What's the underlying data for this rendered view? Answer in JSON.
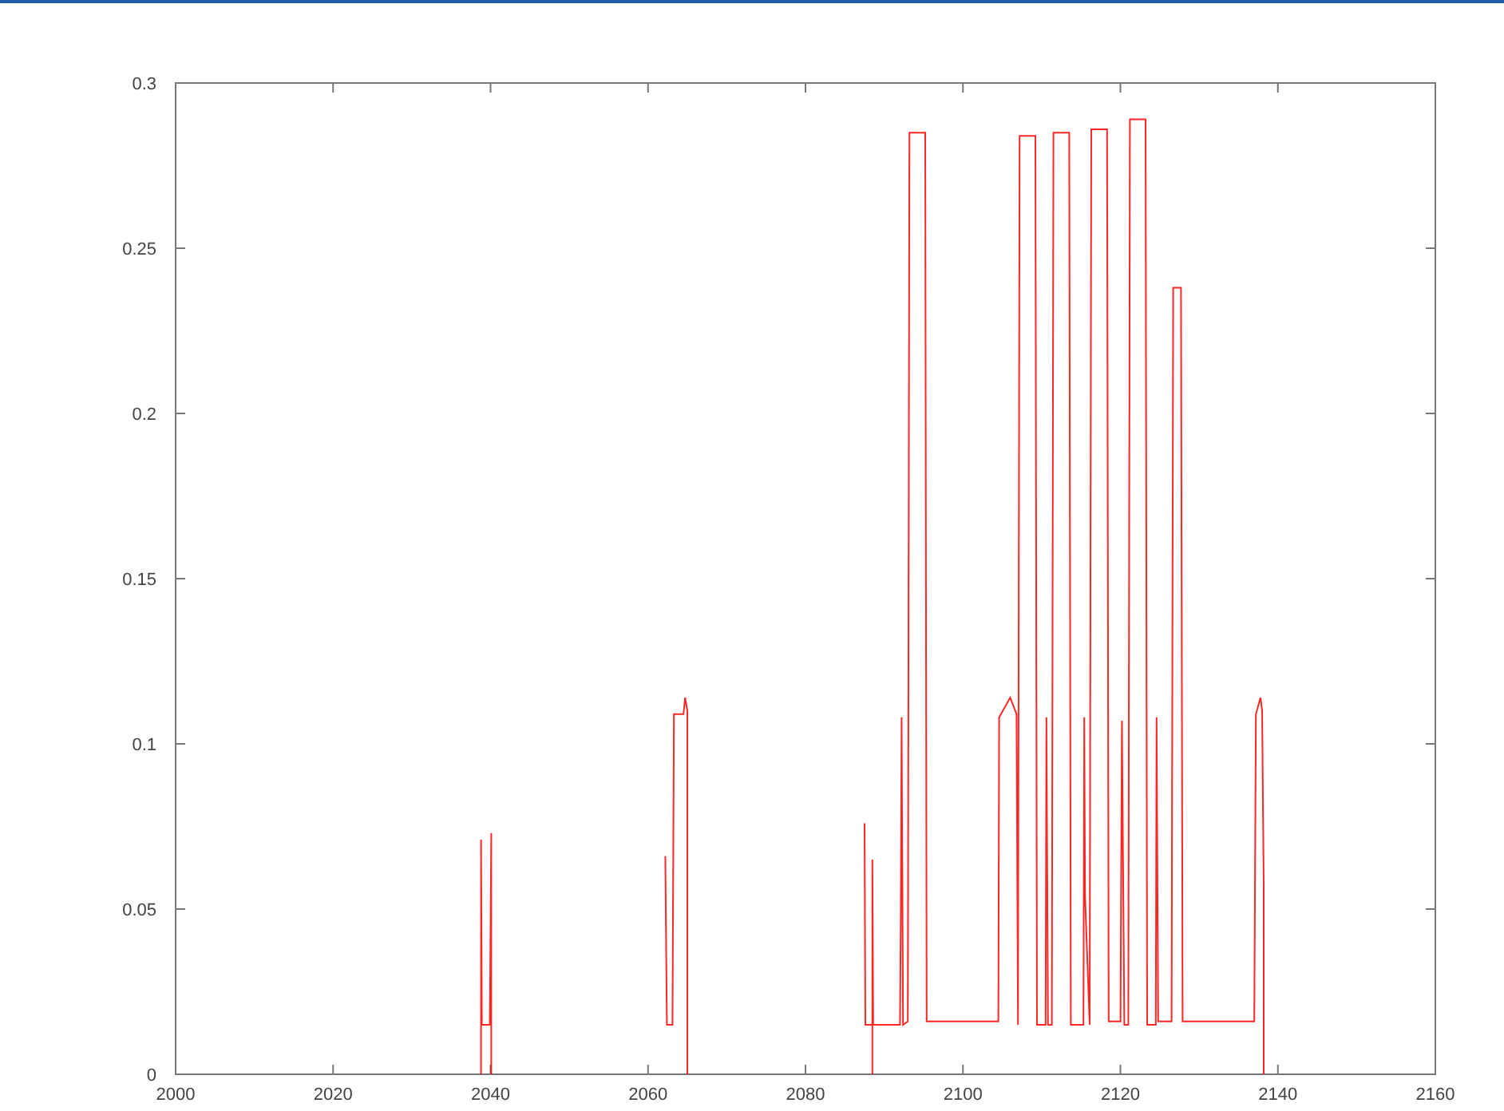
{
  "chart_data": {
    "type": "line",
    "xlim": [
      2000,
      2160
    ],
    "ylim": [
      0,
      0.3
    ],
    "xticks": [
      2000,
      2020,
      2040,
      2060,
      2080,
      2100,
      2120,
      2140,
      2160
    ],
    "yticks": [
      0,
      0.05,
      0.1,
      0.15,
      0.2,
      0.25,
      0.3
    ],
    "x": [
      2038.8,
      2038.8,
      2038.9,
      2039.9,
      2040.1,
      2040.1,
      2062.2,
      2062.4,
      2063.1,
      2063.3,
      2064.5,
      2064.7,
      2065,
      2065,
      2087.5,
      2087.6,
      2088.5,
      2088.5,
      2088.5,
      2088.6,
      2092,
      2092.1,
      2092.2,
      2092.4,
      2093,
      2093.2,
      2095.2,
      2095.4,
      2104.5,
      2104.6,
      2106,
      2106.8,
      2107,
      2107.2,
      2109.2,
      2109.4,
      2110.5,
      2110.6,
      2110.8,
      2111.3,
      2111.5,
      2113.5,
      2113.7,
      2115.3,
      2115.4,
      2115.5,
      2116.1,
      2116.3,
      2118.3,
      2118.5,
      2120,
      2120.2,
      2120.5,
      2121,
      2121.2,
      2123.2,
      2123.4,
      2124.5,
      2124.6,
      2124.8,
      2126.5,
      2126.7,
      2127.7,
      2127.9,
      2137,
      2137.2,
      2137.8,
      2138,
      2138.2,
      2138.2,
      2138.2
    ],
    "series": [
      {
        "color": "#ff0000",
        "values": [
          0,
          0.071,
          0.015,
          0.015,
          0.073,
          0,
          0.066,
          0.015,
          0.015,
          0.109,
          0.109,
          0.114,
          0.11,
          0,
          0.076,
          0.015,
          0.015,
          0,
          0.065,
          0.015,
          0.015,
          0.047,
          0.108,
          0.015,
          0.016,
          0.285,
          0.285,
          0.016,
          0.016,
          0.108,
          0.114,
          0.109,
          0.015,
          0.284,
          0.284,
          0.015,
          0.015,
          0.108,
          0.015,
          0.015,
          0.285,
          0.285,
          0.015,
          0.015,
          0.108,
          0.054,
          0.015,
          0.286,
          0.286,
          0.016,
          0.016,
          0.107,
          0.015,
          0.015,
          0.289,
          0.289,
          0.015,
          0.015,
          0.108,
          0.016,
          0.016,
          0.238,
          0.238,
          0.016,
          0.016,
          0.109,
          0.114,
          0.11,
          0.057,
          0,
          0
        ]
      }
    ]
  }
}
